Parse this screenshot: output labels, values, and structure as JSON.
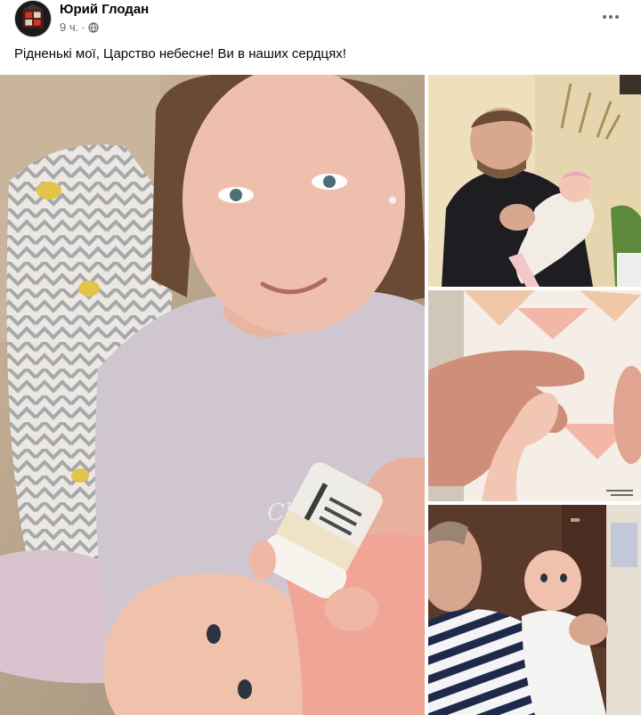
{
  "post": {
    "author": "Юрий Глодан",
    "time": "9 ч.",
    "separator": "·",
    "privacy_icon": "globe-icon",
    "more_icon": "more-options-icon",
    "text": "Рідненькі мої, Царство небесне! Ви в наших сердцях!"
  },
  "photos": {
    "count": 4,
    "caption_on_shirt": "Cla.. Ae great"
  }
}
